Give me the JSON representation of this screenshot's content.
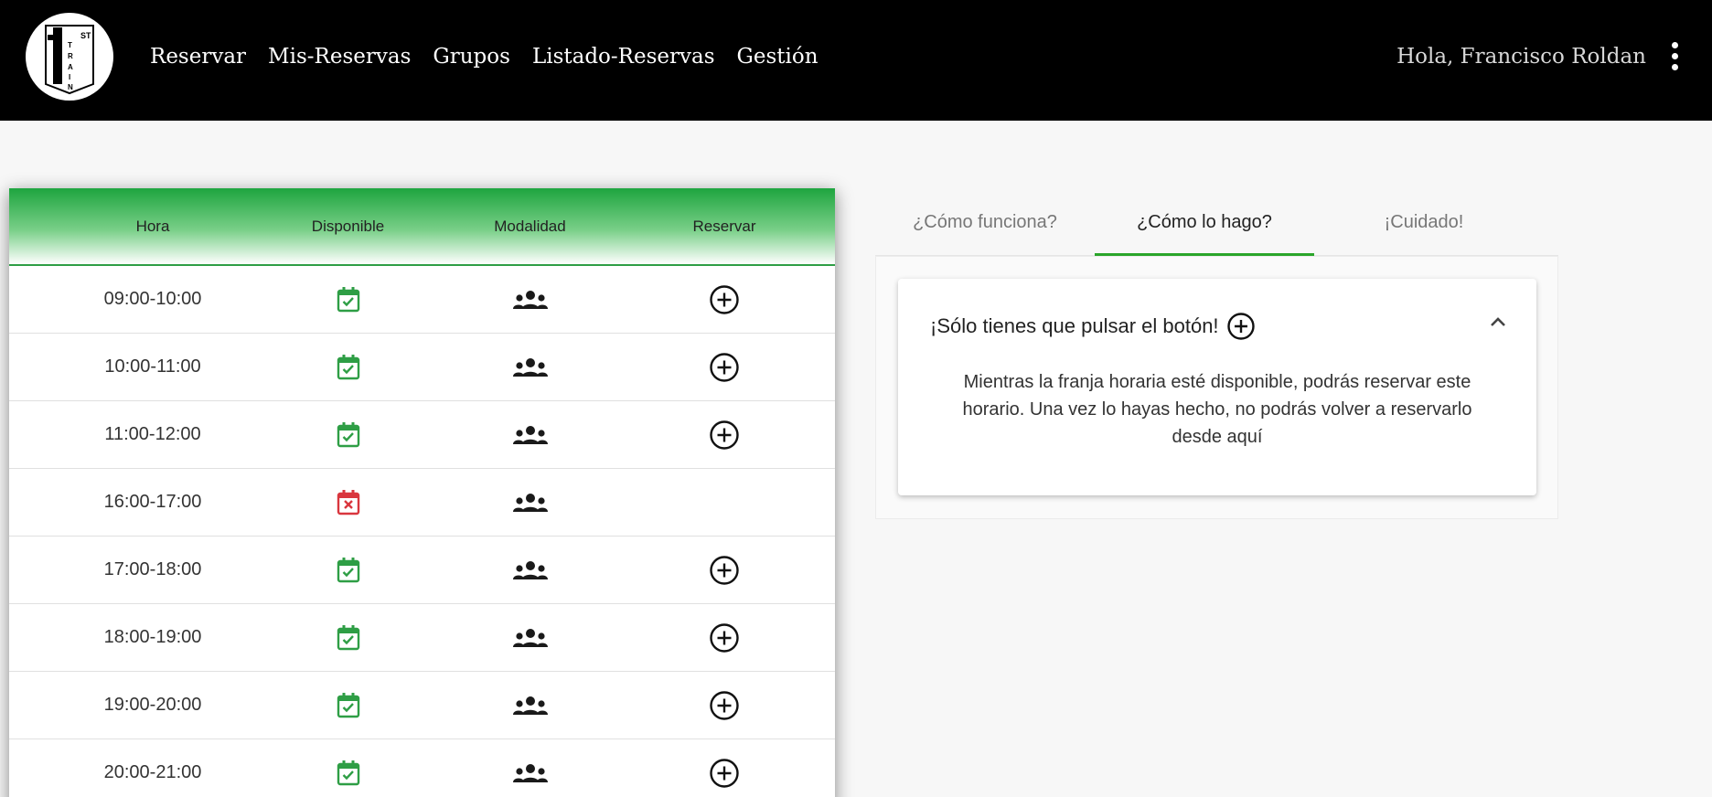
{
  "header": {
    "logo_icon": "first-train-logo",
    "logo_text": "1 ST TRAIN",
    "nav": [
      {
        "label": "Reservar"
      },
      {
        "label": "Mis-Reservas"
      },
      {
        "label": "Grupos"
      },
      {
        "label": "Listado-Reservas"
      },
      {
        "label": "Gestión"
      }
    ],
    "greeting": "Hola, Francisco Roldan",
    "menu_icon": "more-vert-icon"
  },
  "table": {
    "headers": {
      "hora": "Hora",
      "disponible": "Disponible",
      "modalidad": "Modalidad",
      "reservar": "Reservar"
    },
    "rows": [
      {
        "hora": "09:00-10:00",
        "disponible": true,
        "modalidad": "group-icon",
        "reservable": true
      },
      {
        "hora": "10:00-11:00",
        "disponible": true,
        "modalidad": "group-icon",
        "reservable": true
      },
      {
        "hora": "11:00-12:00",
        "disponible": true,
        "modalidad": "group-icon",
        "reservable": true
      },
      {
        "hora": "16:00-17:00",
        "disponible": false,
        "modalidad": "group-icon",
        "reservable": false
      },
      {
        "hora": "17:00-18:00",
        "disponible": true,
        "modalidad": "group-icon",
        "reservable": true
      },
      {
        "hora": "18:00-19:00",
        "disponible": true,
        "modalidad": "group-icon",
        "reservable": true
      },
      {
        "hora": "19:00-20:00",
        "disponible": true,
        "modalidad": "group-icon",
        "reservable": true
      },
      {
        "hora": "20:00-21:00",
        "disponible": true,
        "modalidad": "group-icon",
        "reservable": true
      }
    ]
  },
  "help": {
    "tabs": [
      {
        "label": "¿Cómo funciona?",
        "active": false
      },
      {
        "label": "¿Cómo lo hago?",
        "active": true
      },
      {
        "label": "¡Cuidado!",
        "active": false
      }
    ],
    "panel_title": "¡Sólo tienes que pulsar el botón!",
    "panel_body": "Mientras la franja horaria esté disponible, podrás reservar este horario. Una vez lo hayas hecho, no podrás volver a reservarlo desde aquí"
  },
  "colors": {
    "header_bg": "#000000",
    "accent_green": "#2aa52a",
    "available": "#2e9e45",
    "unavailable": "#d9363e"
  }
}
